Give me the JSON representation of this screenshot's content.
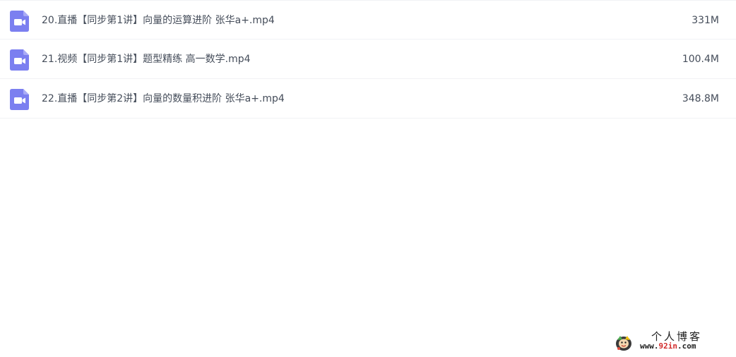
{
  "colors": {
    "video_icon_fill": "#7b7ff0",
    "video_icon_fold": "#a9abf6",
    "text": "#454d5a",
    "row_divider": "#f1f2f5",
    "watermark_accent": "#d22a2a"
  },
  "files": [
    {
      "icon": "video-file-icon",
      "name": "20.直播【同步第1讲】向量的运算进阶 张华a+.mp4",
      "size": "331M"
    },
    {
      "icon": "video-file-icon",
      "name": "21.视频【同步第1讲】题型精练 高一数学.mp4",
      "size": "100.4M"
    },
    {
      "icon": "video-file-icon",
      "name": "22.直播【同步第2讲】向量的数量积进阶 张华a+.mp4",
      "size": "348.8M"
    }
  ],
  "watermark": {
    "title": "个人博客",
    "url_prefix": "www.",
    "url_accent": "92in",
    "url_suffix": ".com"
  }
}
